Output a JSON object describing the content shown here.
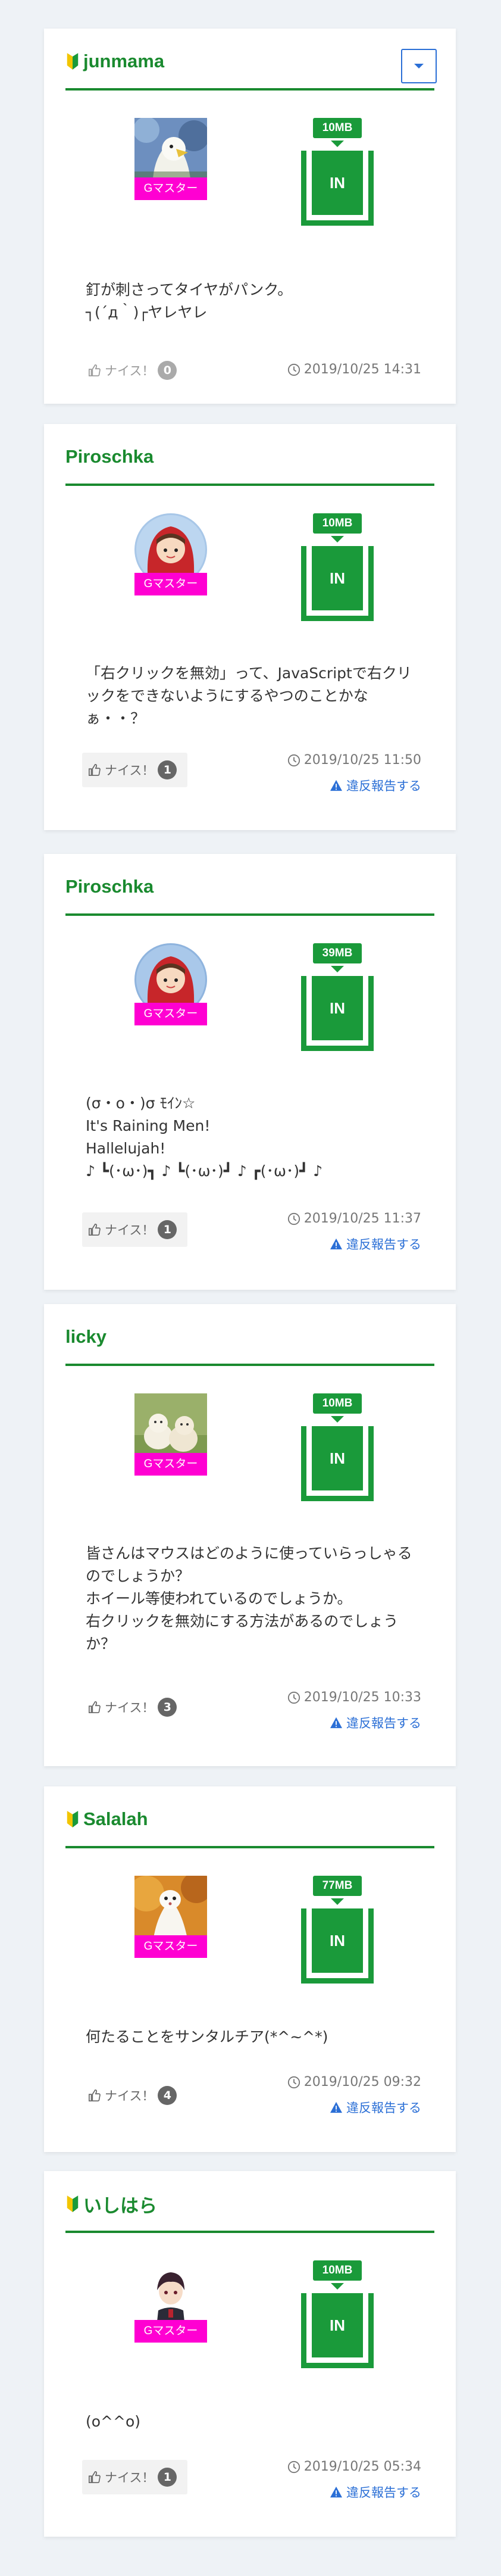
{
  "common": {
    "badge_label": "Gマスター",
    "in_label": "IN",
    "nice_label": "ナイス！",
    "report_label": "違反報告する"
  },
  "posts": [
    {
      "user": "junmama",
      "beginner": true,
      "size": "10MB",
      "message": "釘が刺さってタイヤがパンク。\n┐(´д｀)┌ヤレヤレ",
      "nice_count": "0",
      "timestamp": "2019/10/25 14:31",
      "has_report": false,
      "has_menu": true
    },
    {
      "user": "Piroschka",
      "beginner": false,
      "size": "10MB",
      "message": "「右クリックを無効」って、JavaScriptで右クリックをできないようにするやつのことかなぁ・・？",
      "nice_count": "1",
      "timestamp": "2019/10/25 11:50",
      "has_report": true
    },
    {
      "user": "Piroschka",
      "beginner": false,
      "size": "39MB",
      "message": "(σ・ο・)σ ﾓｲﾝ☆\nIt's Raining Men!\nHallelujah!\n♪ ┗(･ω･)┓ ♪ ┗(･ω･)┛ ♪ ┏(･ω･)┛ ♪",
      "nice_count": "1",
      "timestamp": "2019/10/25 11:37",
      "has_report": true
    },
    {
      "user": "licky",
      "beginner": false,
      "size": "10MB",
      "message": "皆さんはマウスはどのように使っていらっしゃるのでしょうか？\nホイール等使われているのでしょうか。\n右クリックを無効にする方法があるのでしょうか？",
      "nice_count": "3",
      "timestamp": "2019/10/25 10:33",
      "has_report": true
    },
    {
      "user": "Salalah",
      "beginner": true,
      "size": "77MB",
      "message": "何たることをサンタルチア(*^~^*)",
      "nice_count": "4",
      "timestamp": "2019/10/25 09:32",
      "has_report": true
    },
    {
      "user": "いしはら",
      "beginner": true,
      "size": "10MB",
      "message": "(o^^o)",
      "nice_count": "1",
      "timestamp": "2019/10/25 05:34",
      "has_report": true
    }
  ]
}
